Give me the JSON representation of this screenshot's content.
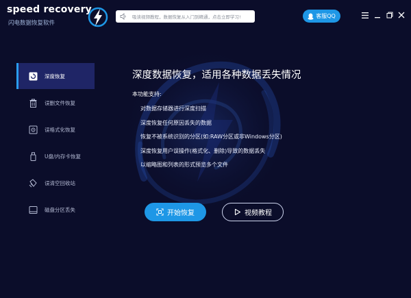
{
  "app": {
    "logo_title": "speed recovery",
    "logo_subtitle": "闪电数据恢复软件",
    "notice_text": "吸读视频教程，数据恢复从入门到精通，点击立即学习!",
    "qq_button": "客服QQ"
  },
  "window_controls": [
    "menu",
    "minimize",
    "restore",
    "close"
  ],
  "sidebar": {
    "items": [
      {
        "label": "深度恢复",
        "icon": "deep-recovery-icon",
        "active": true
      },
      {
        "label": "误删文件恢复",
        "icon": "trash-icon",
        "active": false
      },
      {
        "label": "误格式化恢复",
        "icon": "format-disk-icon",
        "active": false
      },
      {
        "label": "U盘/内存卡恢复",
        "icon": "usb-drive-icon",
        "active": false
      },
      {
        "label": "误清空回收站",
        "icon": "recycle-bin-icon",
        "active": false
      },
      {
        "label": "磁盘分区丢失",
        "icon": "disk-partition-icon",
        "active": false
      }
    ]
  },
  "main": {
    "title": "深度数据恢复，适用各种数据丢失情况",
    "support_heading": "本功能支持:",
    "features": [
      "对数据存储器进行深度扫描",
      "深度恢复任何原因丢失的数据",
      "恢复不被系统识别的分区(如:RAW分区或非Windows分区)",
      "深度恢复用户误操作(格式化、删除)导致的数据丢失",
      "以缩略图和列表的形式预览多个文件"
    ],
    "start_button": "开始恢复",
    "video_button": "视频教程"
  },
  "colors": {
    "background": "#0b0d2a",
    "accent": "#1e97e6",
    "sidebar_active": "#1f2566"
  }
}
